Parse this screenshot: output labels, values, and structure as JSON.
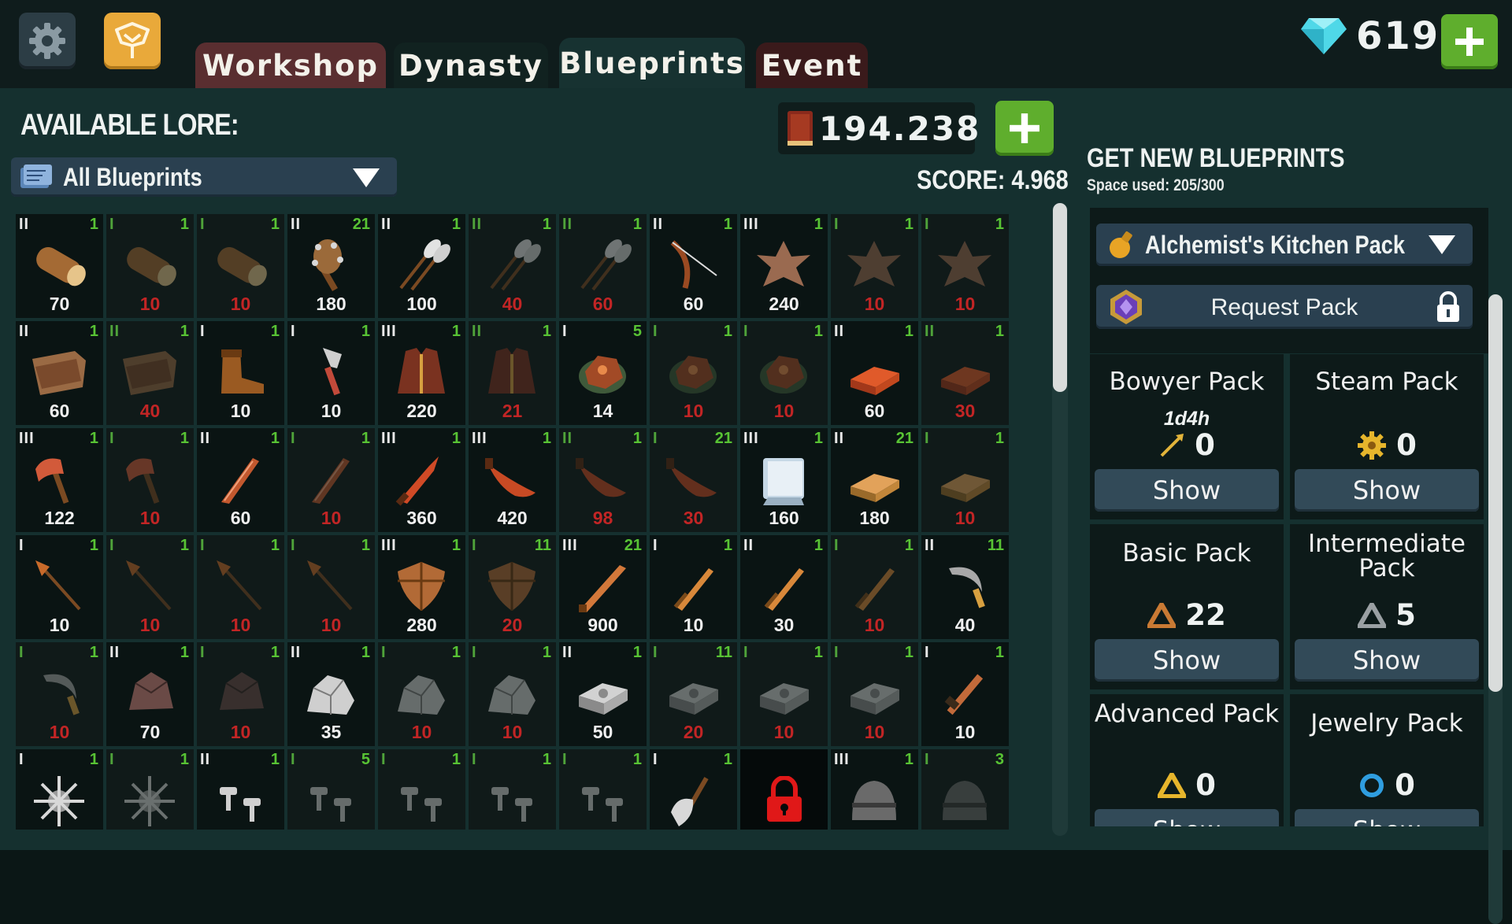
{
  "tabs": [
    {
      "label": "Workshop"
    },
    {
      "label": "Dynasty"
    },
    {
      "label": "Blueprints"
    },
    {
      "label": "Event"
    }
  ],
  "active_tab": "Blueprints",
  "gems": {
    "value": "619"
  },
  "lore": {
    "title": "AVAILABLE LORE:",
    "value": "194.238"
  },
  "filter": {
    "selected": "All Blueprints"
  },
  "score": {
    "label": "SCORE: 4.968"
  },
  "right": {
    "title": "GET NEW BLUEPRINTS",
    "space": "Space used: 205/300",
    "pack_selected": "Alchemist's Kitchen Pack",
    "request_label": "Request Pack"
  },
  "packs": [
    {
      "name": "Bowyer Pack",
      "timer": "1d4h",
      "count": "0",
      "icon": "arrow-icon",
      "button": "Show"
    },
    {
      "name": "Steam Pack",
      "timer": "",
      "count": "0",
      "icon": "gear-icon",
      "button": "Show"
    },
    {
      "name": "Basic Pack",
      "timer": "",
      "count": "22",
      "icon": "triangle-bronze-icon",
      "button": "Show"
    },
    {
      "name": "Intermediate Pack",
      "timer": "",
      "count": "5",
      "icon": "triangle-silver-icon",
      "button": "Show"
    },
    {
      "name": "Advanced Pack",
      "timer": "",
      "count": "0",
      "icon": "triangle-gold-icon",
      "button": "Show"
    },
    {
      "name": "Jewelry Pack",
      "timer": "",
      "count": "0",
      "icon": "ring-icon",
      "button": "Show"
    }
  ],
  "blueprints": [
    [
      {
        "tier": "II",
        "stock": "1",
        "qty": "70",
        "icon": "log",
        "owned": true
      },
      {
        "tier": "I",
        "stock": "1",
        "qty": "10",
        "icon": "log",
        "owned": false
      },
      {
        "tier": "I",
        "stock": "1",
        "qty": "10",
        "icon": "log",
        "owned": false
      },
      {
        "tier": "II",
        "stock": "21",
        "qty": "180",
        "icon": "club",
        "owned": true
      },
      {
        "tier": "II",
        "stock": "1",
        "qty": "100",
        "icon": "feathers",
        "owned": true
      },
      {
        "tier": "II",
        "stock": "1",
        "qty": "40",
        "icon": "feathers",
        "owned": false
      },
      {
        "tier": "II",
        "stock": "1",
        "qty": "60",
        "icon": "feathers",
        "owned": false
      },
      {
        "tier": "II",
        "stock": "1",
        "qty": "60",
        "icon": "bow",
        "owned": true
      },
      {
        "tier": "III",
        "stock": "1",
        "qty": "240",
        "icon": "hide",
        "owned": true
      },
      {
        "tier": "I",
        "stock": "1",
        "qty": "10",
        "icon": "hide",
        "owned": false
      },
      {
        "tier": "I",
        "stock": "1",
        "qty": "10",
        "icon": "hide",
        "owned": false
      }
    ],
    [
      {
        "tier": "II",
        "stock": "1",
        "qty": "60",
        "icon": "leather",
        "owned": true
      },
      {
        "tier": "II",
        "stock": "1",
        "qty": "40",
        "icon": "leather",
        "owned": false
      },
      {
        "tier": "I",
        "stock": "1",
        "qty": "10",
        "icon": "boot",
        "owned": true
      },
      {
        "tier": "I",
        "stock": "1",
        "qty": "10",
        "icon": "dagger",
        "owned": true
      },
      {
        "tier": "III",
        "stock": "1",
        "qty": "220",
        "icon": "coat",
        "owned": true
      },
      {
        "tier": "II",
        "stock": "1",
        "qty": "21",
        "icon": "coat",
        "owned": false
      },
      {
        "tier": "I",
        "stock": "5",
        "qty": "14",
        "icon": "ore",
        "owned": true
      },
      {
        "tier": "I",
        "stock": "1",
        "qty": "10",
        "icon": "ore",
        "owned": false
      },
      {
        "tier": "I",
        "stock": "1",
        "qty": "10",
        "icon": "ore",
        "owned": false
      },
      {
        "tier": "II",
        "stock": "1",
        "qty": "60",
        "icon": "ingot-red",
        "owned": true
      },
      {
        "tier": "II",
        "stock": "1",
        "qty": "30",
        "icon": "ingot-red",
        "owned": false
      }
    ],
    [
      {
        "tier": "III",
        "stock": "1",
        "qty": "122",
        "icon": "axe",
        "owned": true
      },
      {
        "tier": "I",
        "stock": "1",
        "qty": "10",
        "icon": "axe",
        "owned": false
      },
      {
        "tier": "II",
        "stock": "1",
        "qty": "60",
        "icon": "blade",
        "owned": true
      },
      {
        "tier": "I",
        "stock": "1",
        "qty": "10",
        "icon": "blade",
        "owned": false
      },
      {
        "tier": "III",
        "stock": "1",
        "qty": "360",
        "icon": "knife",
        "owned": true
      },
      {
        "tier": "III",
        "stock": "1",
        "qty": "420",
        "icon": "scimitar",
        "owned": true
      },
      {
        "tier": "II",
        "stock": "1",
        "qty": "98",
        "icon": "scimitar",
        "owned": false
      },
      {
        "tier": "I",
        "stock": "21",
        "qty": "30",
        "icon": "scimitar",
        "owned": false
      },
      {
        "tier": "III",
        "stock": "1",
        "qty": "160",
        "icon": "cloth",
        "owned": true
      },
      {
        "tier": "II",
        "stock": "21",
        "qty": "180",
        "icon": "ingot-bronze",
        "owned": true
      },
      {
        "tier": "I",
        "stock": "1",
        "qty": "10",
        "icon": "ingot-bronze",
        "owned": false
      }
    ],
    [
      {
        "tier": "I",
        "stock": "1",
        "qty": "10",
        "icon": "spear",
        "owned": true
      },
      {
        "tier": "I",
        "stock": "1",
        "qty": "10",
        "icon": "spear",
        "owned": false
      },
      {
        "tier": "I",
        "stock": "1",
        "qty": "10",
        "icon": "spear",
        "owned": false
      },
      {
        "tier": "I",
        "stock": "1",
        "qty": "10",
        "icon": "spear",
        "owned": false
      },
      {
        "tier": "III",
        "stock": "1",
        "qty": "280",
        "icon": "shield",
        "owned": true
      },
      {
        "tier": "I",
        "stock": "11",
        "qty": "20",
        "icon": "shield",
        "owned": false
      },
      {
        "tier": "III",
        "stock": "21",
        "qty": "900",
        "icon": "longblade",
        "owned": true
      },
      {
        "tier": "I",
        "stock": "1",
        "qty": "10",
        "icon": "sword",
        "owned": true
      },
      {
        "tier": "II",
        "stock": "1",
        "qty": "30",
        "icon": "sword",
        "owned": true
      },
      {
        "tier": "I",
        "stock": "1",
        "qty": "10",
        "icon": "sword",
        "owned": false
      },
      {
        "tier": "II",
        "stock": "11",
        "qty": "40",
        "icon": "sickle",
        "owned": true
      }
    ],
    [
      {
        "tier": "I",
        "stock": "1",
        "qty": "10",
        "icon": "sickle",
        "owned": false
      },
      {
        "tier": "II",
        "stock": "1",
        "qty": "70",
        "icon": "rock",
        "owned": true
      },
      {
        "tier": "I",
        "stock": "1",
        "qty": "10",
        "icon": "rock",
        "owned": false
      },
      {
        "tier": "II",
        "stock": "1",
        "qty": "35",
        "icon": "stone",
        "owned": true
      },
      {
        "tier": "I",
        "stock": "1",
        "qty": "10",
        "icon": "stone",
        "owned": false
      },
      {
        "tier": "I",
        "stock": "1",
        "qty": "10",
        "icon": "stone",
        "owned": false
      },
      {
        "tier": "II",
        "stock": "1",
        "qty": "50",
        "icon": "ingot-iron",
        "owned": true
      },
      {
        "tier": "I",
        "stock": "11",
        "qty": "20",
        "icon": "ingot-iron",
        "owned": false
      },
      {
        "tier": "I",
        "stock": "1",
        "qty": "10",
        "icon": "ingot-iron",
        "owned": false
      },
      {
        "tier": "I",
        "stock": "1",
        "qty": "10",
        "icon": "ingot-iron",
        "owned": false
      },
      {
        "tier": "I",
        "stock": "1",
        "qty": "10",
        "icon": "chisel",
        "owned": true
      }
    ],
    [
      {
        "tier": "I",
        "stock": "1",
        "qty": "",
        "icon": "spikeball",
        "owned": true
      },
      {
        "tier": "I",
        "stock": "1",
        "qty": "",
        "icon": "spikeball",
        "owned": false
      },
      {
        "tier": "II",
        "stock": "1",
        "qty": "",
        "icon": "bolts",
        "owned": true
      },
      {
        "tier": "I",
        "stock": "5",
        "qty": "",
        "icon": "bolts",
        "owned": false
      },
      {
        "tier": "I",
        "stock": "1",
        "qty": "",
        "icon": "bolts",
        "owned": false
      },
      {
        "tier": "I",
        "stock": "1",
        "qty": "",
        "icon": "bolts",
        "owned": false
      },
      {
        "tier": "I",
        "stock": "1",
        "qty": "",
        "icon": "bolts",
        "owned": false
      },
      {
        "tier": "I",
        "stock": "1",
        "qty": "",
        "icon": "shovel",
        "owned": true
      },
      {
        "tier": "",
        "stock": "",
        "qty": "",
        "icon": "lock",
        "owned": true,
        "locked": true
      },
      {
        "tier": "III",
        "stock": "1",
        "qty": "",
        "icon": "helmet",
        "owned": true
      },
      {
        "tier": "I",
        "stock": "3",
        "qty": "",
        "icon": "helmet",
        "owned": false
      }
    ]
  ],
  "colors": {
    "accent_green": "#5fae2d",
    "missing_red": "#c22525",
    "stock_green": "#58c334",
    "panel_teal": "#15302f"
  }
}
